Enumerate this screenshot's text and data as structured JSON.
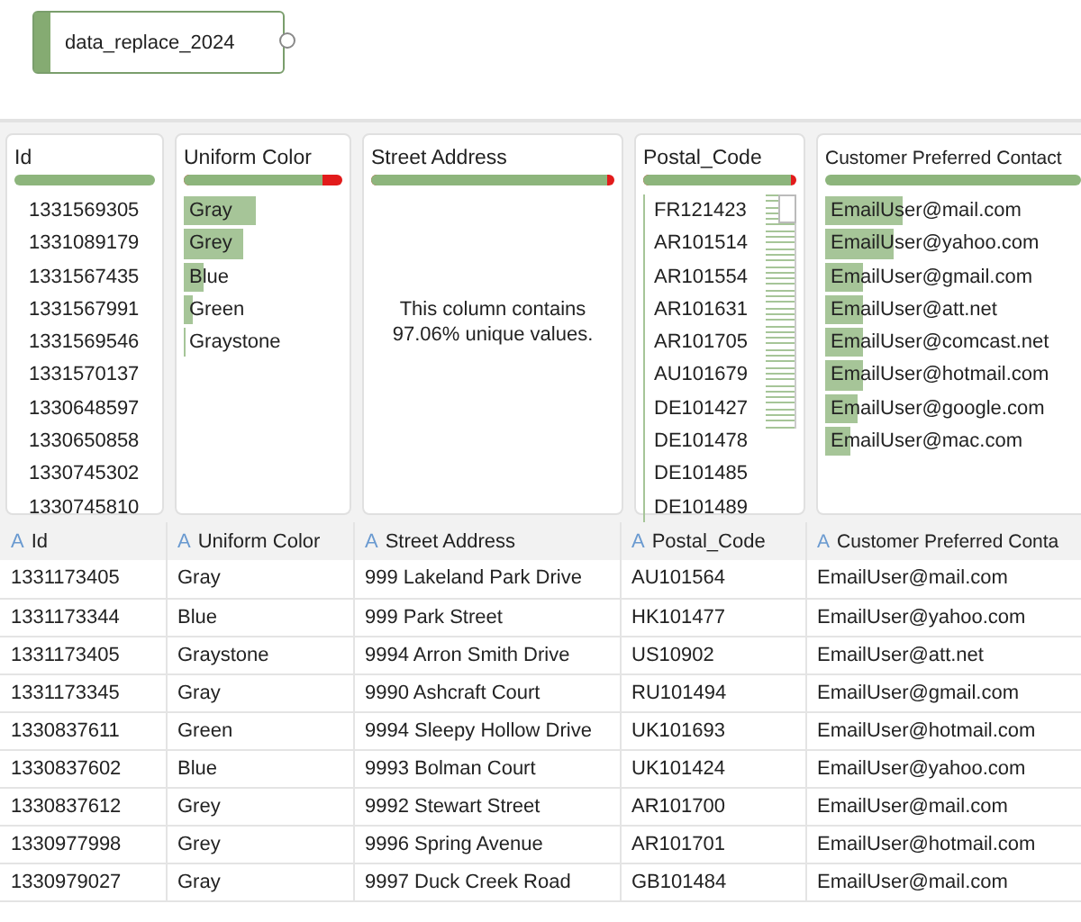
{
  "node": {
    "label": "data_replace_2024"
  },
  "profile_cards": [
    {
      "title": "Id",
      "kind": "values",
      "level": 1.0,
      "items": [
        {
          "text": "1331569305"
        },
        {
          "text": "1331089179"
        },
        {
          "text": "1331567435"
        },
        {
          "text": "1331567991"
        },
        {
          "text": "1331569546"
        },
        {
          "text": "1331570137"
        },
        {
          "text": "1330648597"
        },
        {
          "text": "1330650858"
        },
        {
          "text": "1330745302"
        },
        {
          "text": "1330745810"
        }
      ]
    },
    {
      "title": "Uniform Color",
      "kind": "bars",
      "level": 0.88,
      "items": [
        {
          "text": "Gray",
          "level": 0.45
        },
        {
          "text": "Grey",
          "level": 0.38
        },
        {
          "text": "Blue",
          "level": 0.13
        },
        {
          "text": "Green",
          "level": 0.06
        },
        {
          "text": "Graystone",
          "level": 0.01
        }
      ]
    },
    {
      "title": "Street Address",
      "kind": "summary",
      "level": 0.97,
      "message": "This column contains 97.06% unique values."
    },
    {
      "title": "Postal_Code",
      "kind": "codes",
      "level": 0.97,
      "items": [
        {
          "text": "FR121423"
        },
        {
          "text": "AR101514"
        },
        {
          "text": "AR101554"
        },
        {
          "text": "AR101631"
        },
        {
          "text": "AR101705"
        },
        {
          "text": "AU101679"
        },
        {
          "text": "DE101427"
        },
        {
          "text": "DE101478"
        },
        {
          "text": "DE101485"
        },
        {
          "text": "DE101489"
        }
      ]
    },
    {
      "title": "Customer Preferred Contact",
      "kind": "bars",
      "level": 1.0,
      "items": [
        {
          "text": "EmailUser@mail.com",
          "level": 0.3
        },
        {
          "text": "EmailUser@yahoo.com",
          "level": 0.27
        },
        {
          "text": "EmailUser@gmail.com",
          "level": 0.15
        },
        {
          "text": "EmailUser@att.net",
          "level": 0.15
        },
        {
          "text": "EmailUser@comcast.net",
          "level": 0.15
        },
        {
          "text": "EmailUser@hotmail.com",
          "level": 0.15
        },
        {
          "text": "EmailUser@google.com",
          "level": 0.13
        },
        {
          "text": "EmailUser@mac.com",
          "level": 0.1
        }
      ]
    }
  ],
  "table": {
    "columns": [
      {
        "type_icon": "A",
        "label": "Id"
      },
      {
        "type_icon": "A",
        "label": "Uniform Color"
      },
      {
        "type_icon": "A",
        "label": "Street Address"
      },
      {
        "type_icon": "A",
        "label": "Postal_Code"
      },
      {
        "type_icon": "A",
        "label": "Customer Preferred Conta"
      }
    ],
    "rows": [
      [
        "1331173405",
        "Gray",
        "999 Lakeland Park Drive",
        "AU101564",
        "EmailUser@mail.com"
      ],
      [
        "1331173344",
        "Blue",
        "999 Park Street",
        "HK101477",
        "EmailUser@yahoo.com"
      ],
      [
        "1331173405",
        "Graystone",
        "9994 Arron Smith Drive",
        "US10902",
        "EmailUser@att.net"
      ],
      [
        "1331173345",
        "Gray",
        "9990 Ashcraft Court",
        "RU101494",
        "EmailUser@gmail.com"
      ],
      [
        "1330837611",
        "Green",
        "9994 Sleepy Hollow Drive",
        "UK101693",
        "EmailUser@hotmail.com"
      ],
      [
        "1330837602",
        "Blue",
        "9993 Bolman Court",
        "UK101424",
        "EmailUser@yahoo.com"
      ],
      [
        "1330837612",
        "Grey",
        "9992 Stewart Street",
        "AR101700",
        "EmailUser@mail.com"
      ],
      [
        "1330977998",
        "Grey",
        "9996 Spring Avenue",
        "AR101701",
        "EmailUser@hotmail.com"
      ],
      [
        "1330979027",
        "Gray",
        "9997 Duck Creek Road",
        "GB101484",
        "EmailUser@mail.com"
      ]
    ]
  }
}
